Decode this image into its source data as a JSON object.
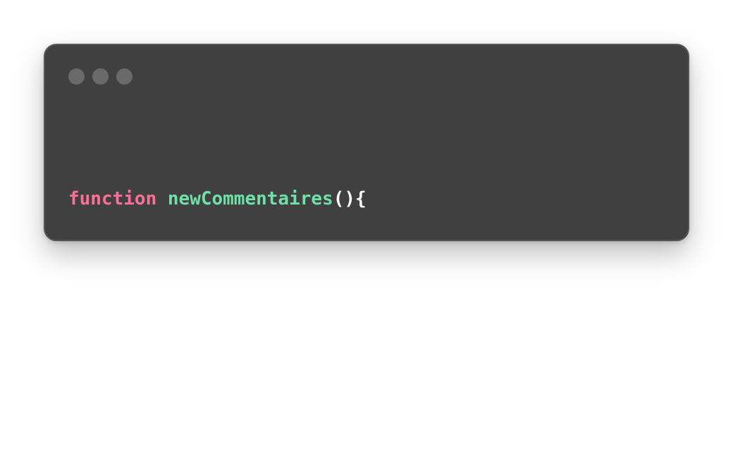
{
  "window": {
    "controls": [
      "window-dot",
      "window-dot",
      "window-dot"
    ]
  },
  "code": {
    "keyword": "function",
    "function_name": "newCommentaires",
    "open_signature": "(){",
    "body": "  ...",
    "close": " }"
  },
  "colors": {
    "background": "#404040",
    "keyword": "#ff6f9a",
    "function_name": "#6fe0a8",
    "text": "#ffffff",
    "window_dot": "#6a6a6a"
  }
}
